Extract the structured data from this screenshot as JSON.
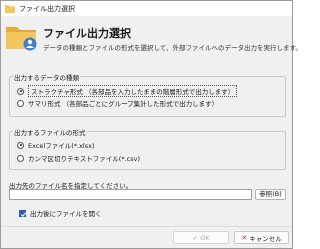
{
  "window": {
    "title": "ファイル出力選択"
  },
  "header": {
    "title": "ファイル出力選択",
    "description": "データの種類とファイルの形式を選択して、外部ファイルへのデータ出力を実行します。"
  },
  "data_type": {
    "label": "出力するデータの種類",
    "options": [
      {
        "label": "ストラクチャ形式 （各部品を入力したままの階層形式で出力します）",
        "checked": true
      },
      {
        "label": "サマリ形式 （各部品ごとにグループ集計した形式で出力します）",
        "checked": false
      }
    ]
  },
  "file_format": {
    "label": "出力するファイルの形式",
    "options": [
      {
        "label": "Excelファイル(*.xlsx)",
        "checked": true
      },
      {
        "label": "カンマ区切りテキストファイル(*.csv)",
        "checked": false
      }
    ]
  },
  "output_path": {
    "label": "出力先のファイル名を指定してください。",
    "value": "",
    "browse_label": "参照(B)"
  },
  "open_after": {
    "label": "出力後にファイルを開く",
    "checked": true
  },
  "footer": {
    "ok_label": "OK",
    "cancel_label": "キャンセル"
  },
  "colors": {
    "accent": "#2f5fa8",
    "cancel_icon": "#d23c2a",
    "folder": "#f2b84b"
  }
}
